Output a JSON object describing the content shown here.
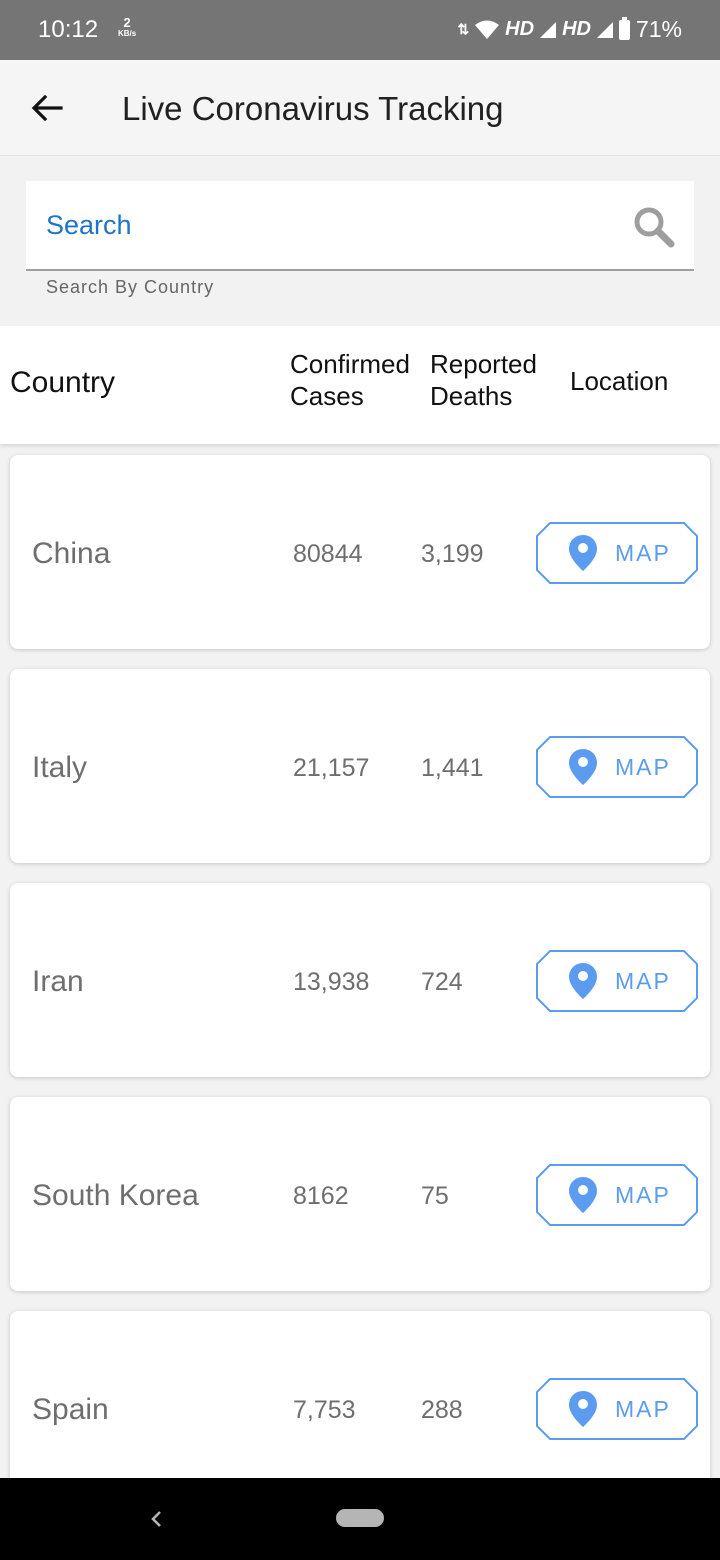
{
  "status_bar": {
    "time": "10:12",
    "net_speed_value": "2",
    "net_speed_unit": "KB/s",
    "hd1": "HD",
    "hd2": "HD",
    "battery": "71%"
  },
  "app_bar": {
    "back_icon": "arrow-left-icon",
    "title": "Live Coronavirus Tracking"
  },
  "search": {
    "placeholder": "Search",
    "helper": "Search By Country",
    "icon": "search-icon"
  },
  "table": {
    "headers": {
      "country": "Country",
      "confirmed_line1": "Confirmed",
      "confirmed_line2": "Cases",
      "deaths_line1": "Reported",
      "deaths_line2": "Deaths",
      "location": "Location"
    },
    "rows": [
      {
        "country": "China",
        "cases": "80844",
        "deaths": "3,199",
        "map_label": "MAP"
      },
      {
        "country": "Italy",
        "cases": "21,157",
        "deaths": "1,441",
        "map_label": "MAP"
      },
      {
        "country": "Iran",
        "cases": "13,938",
        "deaths": "724",
        "map_label": "MAP"
      },
      {
        "country": "South Korea",
        "cases": "8162",
        "deaths": "75",
        "map_label": "MAP"
      },
      {
        "country": "Spain",
        "cases": "7,753",
        "deaths": "288",
        "map_label": "MAP"
      }
    ]
  },
  "colors": {
    "accent_blue": "#1e74c8",
    "map_blue": "#5b9cf0",
    "status_bar": "#757575"
  }
}
